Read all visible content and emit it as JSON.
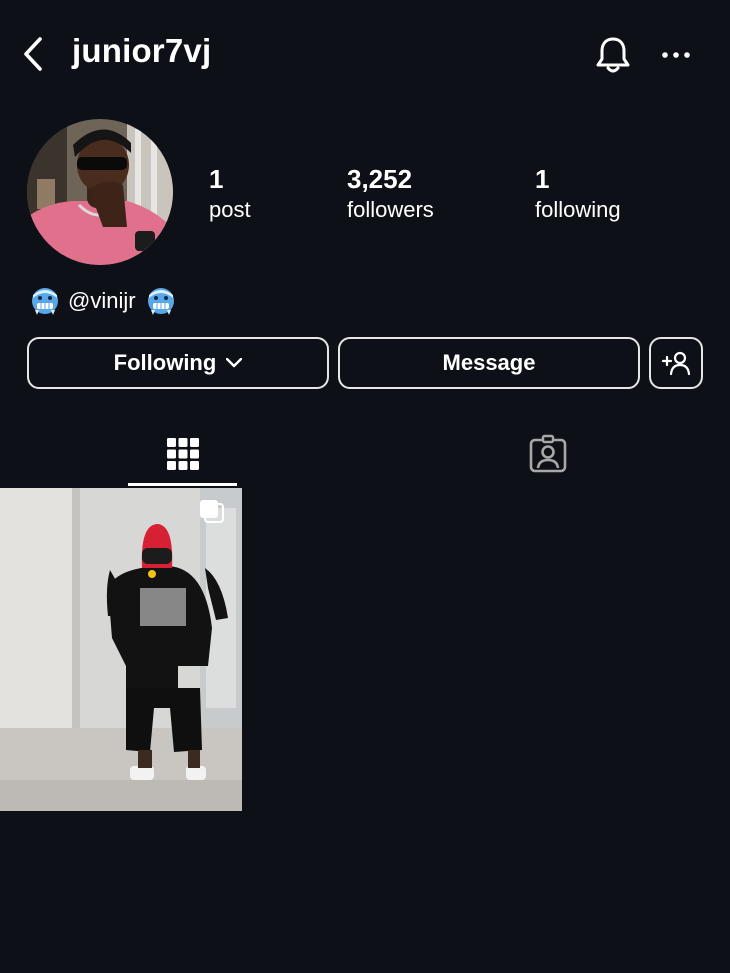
{
  "header": {
    "username": "junior7vj",
    "icons": [
      "back-arrow-icon",
      "bell-icon",
      "more-icon"
    ]
  },
  "profile": {
    "stats": [
      {
        "count": "1",
        "label": "post"
      },
      {
        "count": "3,252",
        "label": "followers"
      },
      {
        "count": "1",
        "label": "following"
      }
    ],
    "bio": "@vinijr",
    "bio_emoji": "cold-face-emoji"
  },
  "actions": {
    "following_label": "Following",
    "message_label": "Message"
  },
  "tabs": [
    {
      "icon": "grid-icon",
      "selected": true
    },
    {
      "icon": "tagged-person-icon",
      "selected": false
    }
  ],
  "posts": [
    {
      "type": "photo",
      "multi": true
    }
  ],
  "colors": {
    "background": "#0d1117",
    "text": "#ffffff",
    "button_border": "#e6e6e6"
  }
}
